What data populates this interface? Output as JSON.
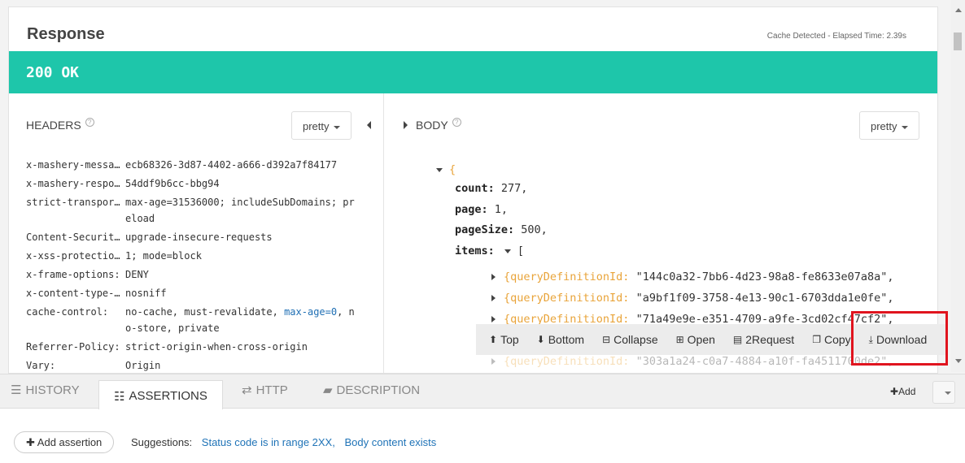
{
  "response": {
    "title": "Response",
    "cache_info": "Cache Detected - Elapsed Time: 2.39s",
    "status": "200 OK",
    "status_color": "#1ec6aa"
  },
  "headers_section": {
    "label": "HEADERS",
    "help": "?",
    "format": "pretty",
    "rows": [
      {
        "key": "x-mashery-messa…",
        "value": "ecb68326-3d87-4402-a666-d392a7f84177"
      },
      {
        "key": "x-mashery-respo…",
        "value": "54ddf9b6cc-bbg94"
      },
      {
        "key": "strict-transpor…",
        "value": "max-age=31536000; includeSubDomains; preload"
      },
      {
        "key": "Content-Securit…",
        "value": "upgrade-insecure-requests"
      },
      {
        "key": "x-xss-protectio…",
        "value": "1; mode=block"
      },
      {
        "key": "x-frame-options:",
        "value": "DENY"
      },
      {
        "key": "x-content-type-…",
        "value": "nosniff"
      },
      {
        "key": "cache-control:",
        "value_a": "no-cache, must-revalidate,",
        "value_b": "max-age=0",
        "value_c": ", no-store, private"
      },
      {
        "key": "Referrer-Policy:",
        "value": "strict-origin-when-cross-origin"
      },
      {
        "key": "Vary:",
        "value": "Origin"
      }
    ]
  },
  "body_section": {
    "label": "BODY",
    "help": "?",
    "format": "pretty",
    "json": {
      "open_brace": "{",
      "count_key": "count:",
      "count_val": "277,",
      "page_key": "page:",
      "page_val": "1,",
      "pagesize_key": "pageSize:",
      "pagesize_val": "500,",
      "items_key": "items:",
      "items_open": "[",
      "items": [
        {
          "key": "{queryDefinitionId:",
          "value": "\"144c0a32-7bb6-4d23-98a8-fe8633e07a8a\","
        },
        {
          "key": "{queryDefinitionId:",
          "value": "\"a9bf1f09-3758-4e13-90c1-6703dda1e0fe\","
        },
        {
          "key": "{queryDefinitionId:",
          "value": "\"71a49e9e-e351-4709-a9fe-3cd02cf47cf2\","
        },
        {
          "key": "{queryDefinitionId:",
          "value": "\"303a1a24-c0a7-4884-a10f-fa4511700de2\","
        }
      ]
    }
  },
  "toolbar": {
    "top": "Top",
    "bottom": "Bottom",
    "collapse": "Collapse",
    "open": "Open",
    "to_request": "2Request",
    "copy": "Copy",
    "download": "Download"
  },
  "tabs": {
    "history": "HISTORY",
    "assertions": "ASSERTIONS",
    "http": "HTTP",
    "description": "DESCRIPTION",
    "add": "Add"
  },
  "assertions": {
    "add_button": "Add assertion",
    "suggestions_label": "Suggestions:",
    "suggestion_1": "Status code is in range 2XX,",
    "suggestion_2": "Body content exists"
  },
  "colors": {
    "highlight": "#e0141e",
    "link": "#1f73b7",
    "brace": "#e9a43a"
  }
}
